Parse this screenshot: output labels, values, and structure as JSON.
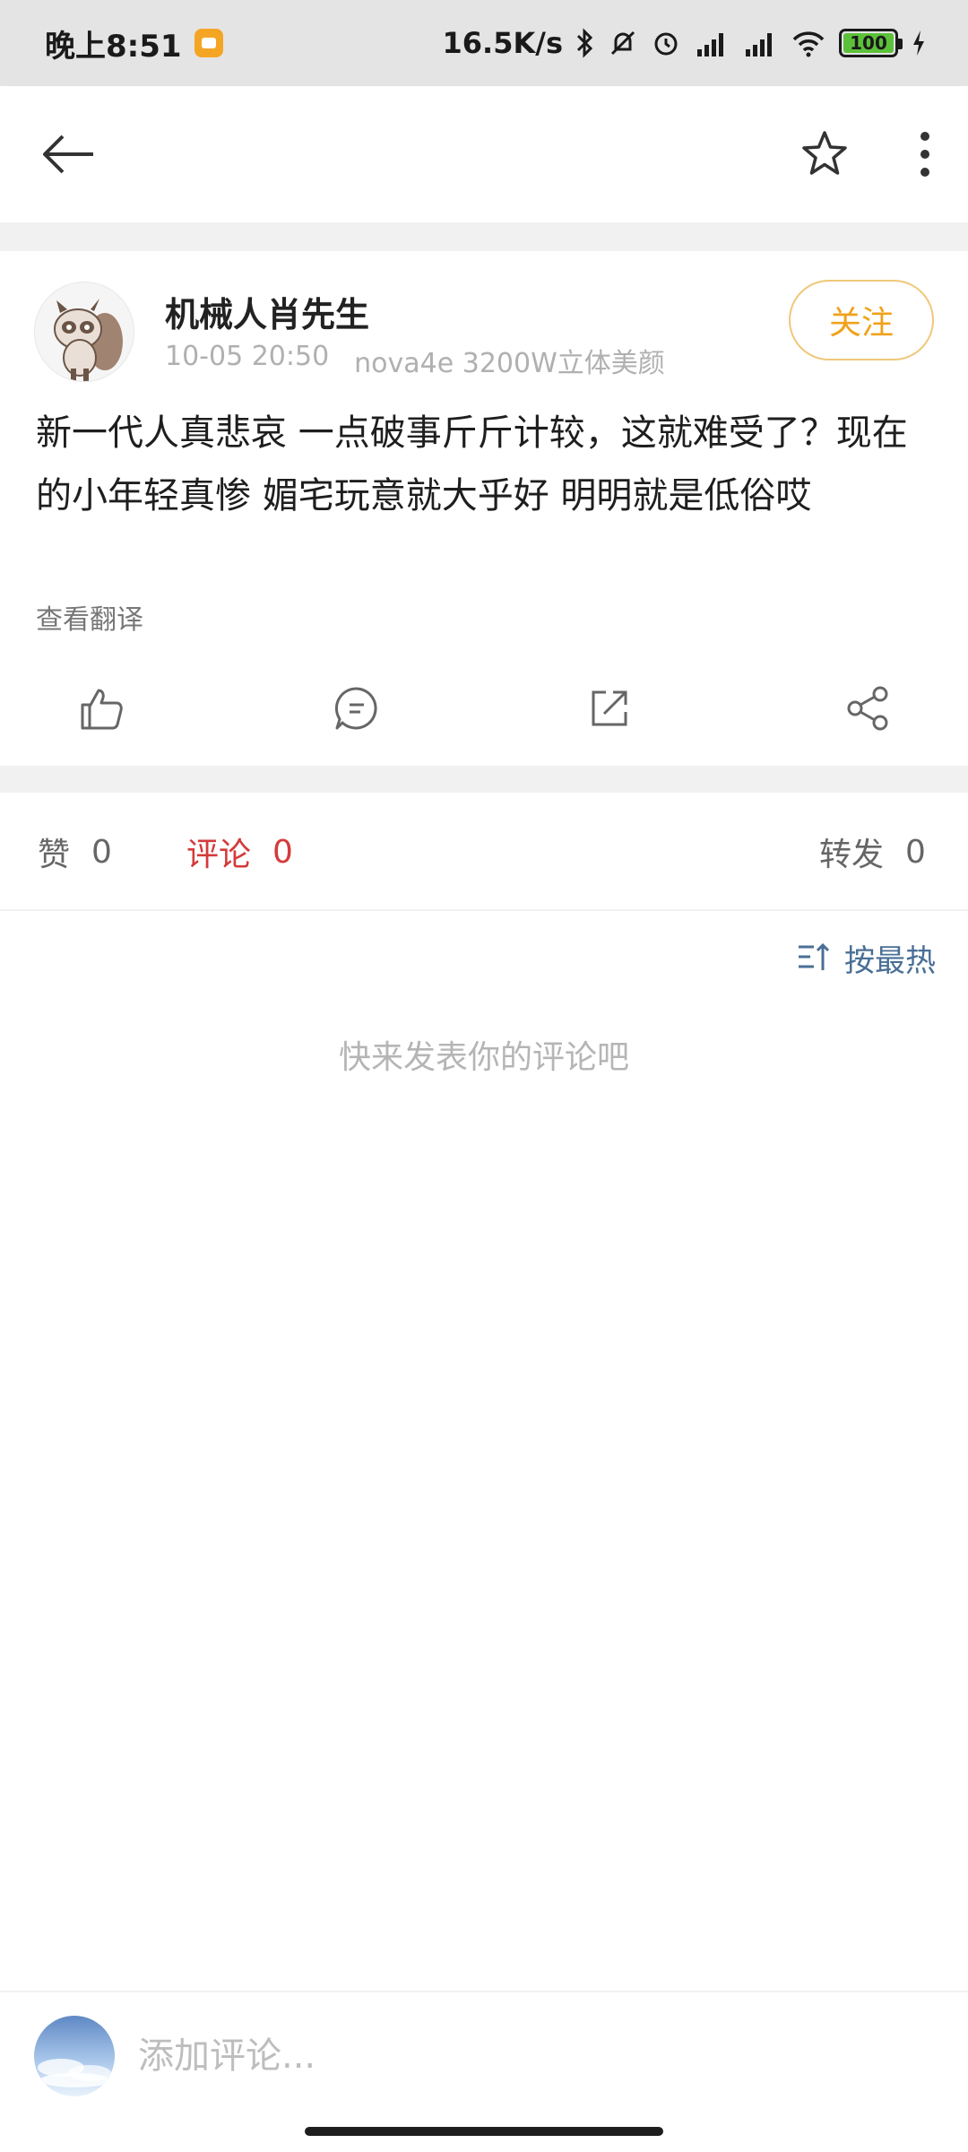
{
  "status_bar": {
    "time": "晚上8:51",
    "network_speed": "16.5K/s",
    "battery": "100"
  },
  "toolbar": {
    "back_icon": "arrow-left-icon",
    "favorite_icon": "star-icon",
    "more_icon": "more-vertical-icon"
  },
  "post": {
    "author": "机械人肖先生",
    "date": "10-05 20:50",
    "device": "nova4e 3200W立体美颜",
    "follow_label": "关注",
    "content": "新一代人真悲哀 一点破事斤斤计较，这就难受了？现在的小年轻真惨 媚宅玩意就大乎好 明明就是低俗哎",
    "translate_label": "查看翻译"
  },
  "stats": {
    "likes_label": "赞",
    "likes_count": "0",
    "comments_label": "评论",
    "comments_count": "0",
    "reposts_label": "转发",
    "reposts_count": "0"
  },
  "sort": {
    "label": "按最热",
    "icon": "sort-icon"
  },
  "empty_comments": "快来发表你的评论吧",
  "comment_bar": {
    "placeholder": "添加评论..."
  },
  "colors": {
    "accent_follow": "#f0a21b",
    "active_tab": "#d43a3a",
    "sort_link": "#4a6f96"
  }
}
